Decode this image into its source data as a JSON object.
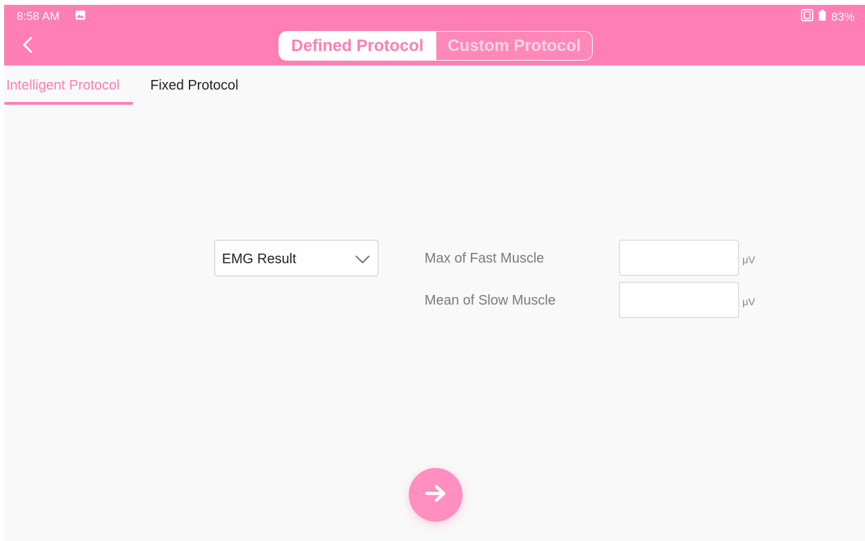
{
  "status_bar": {
    "time": "8:58 AM",
    "battery": "83%"
  },
  "header": {
    "segments": [
      {
        "label": "Defined Protocol",
        "selected": true
      },
      {
        "label": "Custom Protocol",
        "selected": false
      }
    ]
  },
  "subtabs": [
    {
      "label": "Intelligent Protocol",
      "selected": true
    },
    {
      "label": "Fixed Protocol",
      "selected": false
    }
  ],
  "form": {
    "dropdown": {
      "selected": "EMG Result"
    },
    "fields": [
      {
        "label": "Max of Fast Muscle",
        "value": "",
        "unit": "μV"
      },
      {
        "label": "Mean of Slow Muscle",
        "value": "",
        "unit": "μV"
      }
    ]
  },
  "colors": {
    "accent": "#ff7eb3",
    "background": "#f9f9f9"
  },
  "icons": {
    "back": "back-arrow-icon",
    "dropdown": "chevron-down-icon",
    "next": "arrow-right-icon",
    "status_gallery": "image-icon",
    "status_nfc": "nfc-icon",
    "status_battery": "battery-icon"
  }
}
